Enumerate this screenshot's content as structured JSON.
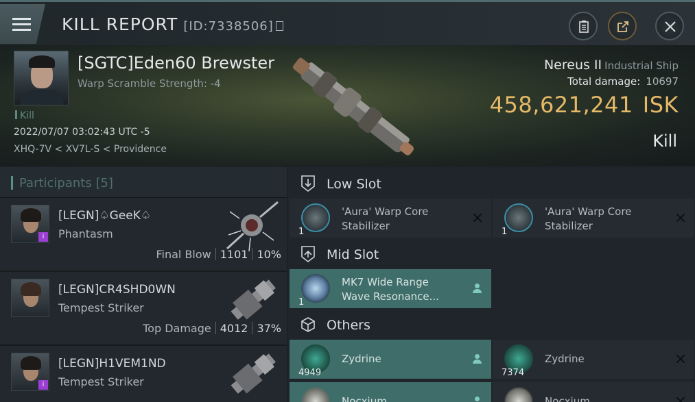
{
  "header": {
    "title": "KILL REPORT",
    "id": "[ID:7338506]"
  },
  "victim": {
    "name": "[SGTC]Eden60 Brewster",
    "warp_scramble": "Warp Scramble Strength: -4",
    "kill_tag": "Kill",
    "datetime": "2022/07/07 03:02:43 UTC -5",
    "location": "XHQ-7V < XV7L-S < Providence",
    "ship_name": "Nereus II",
    "ship_class": "Industrial Ship",
    "total_damage_label": "Total damage:",
    "total_damage": "10697",
    "isk_value": "458,621,241",
    "isk_unit": "ISK",
    "result": "Kill"
  },
  "participants": {
    "label": "Participants [5]",
    "rows": [
      {
        "name": "[LEGN]♤GeeK♤",
        "ship": "Phantasm",
        "role": "Final Blow",
        "damage": "1101",
        "pct": "10%"
      },
      {
        "name": "[LEGN]CR4SHD0WN",
        "ship": "Tempest Striker",
        "role": "Top Damage",
        "damage": "4012",
        "pct": "37%"
      },
      {
        "name": "[LEGN]H1VEM1ND",
        "ship": "Tempest Striker",
        "role": "",
        "damage": "",
        "pct": ""
      }
    ]
  },
  "slots": {
    "low": {
      "label": "Low Slot",
      "items": [
        {
          "qty": "1",
          "name": "'Aura' Warp Core Stabilizer",
          "status": "destroyed"
        },
        {
          "qty": "1",
          "name": "'Aura' Warp Core Stabilizer",
          "status": "destroyed"
        }
      ]
    },
    "mid": {
      "label": "Mid Slot",
      "items": [
        {
          "qty": "1",
          "name": "MK7 Wide Range Wave Resonance...",
          "status": "dropped"
        }
      ]
    },
    "others": {
      "label": "Others",
      "items": [
        {
          "qty": "4949",
          "name": "Zydrine",
          "status": "dropped"
        },
        {
          "qty": "7374",
          "name": "Zydrine",
          "status": "destroyed"
        },
        {
          "qty": "",
          "name": "Nocxium",
          "status": "dropped"
        },
        {
          "qty": "",
          "name": "Nocxium",
          "status": "destroyed"
        }
      ]
    }
  },
  "colors": {
    "isk": "#e5b968",
    "dropped": "#3f6d69",
    "accent": "#5c8f8c"
  }
}
